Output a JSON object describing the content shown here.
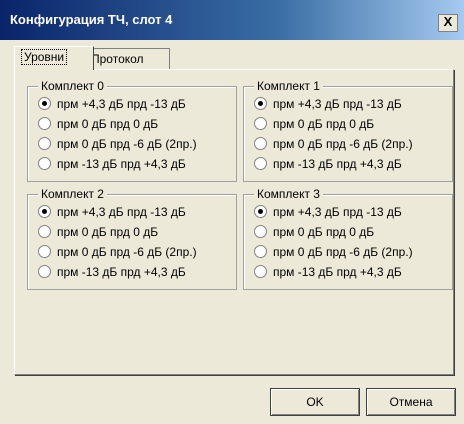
{
  "window": {
    "title": "Конфигурация ТЧ, слот 4",
    "close_glyph": "X"
  },
  "tabs": [
    {
      "label": "Уровни",
      "active": true
    },
    {
      "label": "Протокол",
      "active": false
    }
  ],
  "groups": [
    {
      "legend": "Комплект 0",
      "options": [
        {
          "label": "прм +4,3 дБ  прд -13 дБ",
          "selected": true
        },
        {
          "label": "прм 0 дБ прд 0 дБ",
          "selected": false
        },
        {
          "label": "прм 0 дБ прд -6 дБ (2пр.)",
          "selected": false
        },
        {
          "label": "прм -13 дБ прд +4,3 дБ",
          "selected": false
        }
      ]
    },
    {
      "legend": "Комплект 1",
      "options": [
        {
          "label": "прм +4,3 дБ  прд -13 дБ",
          "selected": true
        },
        {
          "label": "прм 0 дБ прд 0 дБ",
          "selected": false
        },
        {
          "label": "прм 0 дБ прд -6 дБ (2пр.)",
          "selected": false
        },
        {
          "label": "прм -13 дБ прд +4,3 дБ",
          "selected": false
        }
      ]
    },
    {
      "legend": "Комплект 2",
      "options": [
        {
          "label": "прм +4,3 дБ  прд -13 дБ",
          "selected": true
        },
        {
          "label": "прм 0 дБ прд 0 дБ",
          "selected": false
        },
        {
          "label": "прм 0 дБ прд -6 дБ (2пр.)",
          "selected": false
        },
        {
          "label": "прм -13 дБ прд +4,3 дБ",
          "selected": false
        }
      ]
    },
    {
      "legend": "Комплект 3",
      "options": [
        {
          "label": "прм +4,3 дБ  прд -13 дБ",
          "selected": true
        },
        {
          "label": "прм 0 дБ прд 0 дБ",
          "selected": false
        },
        {
          "label": "прм 0 дБ прд -6 дБ (2пр.)",
          "selected": false
        },
        {
          "label": "прм -13 дБ прд +4,3 дБ",
          "selected": false
        }
      ]
    }
  ],
  "buttons": {
    "ok": "OK",
    "cancel": "Отмена"
  }
}
